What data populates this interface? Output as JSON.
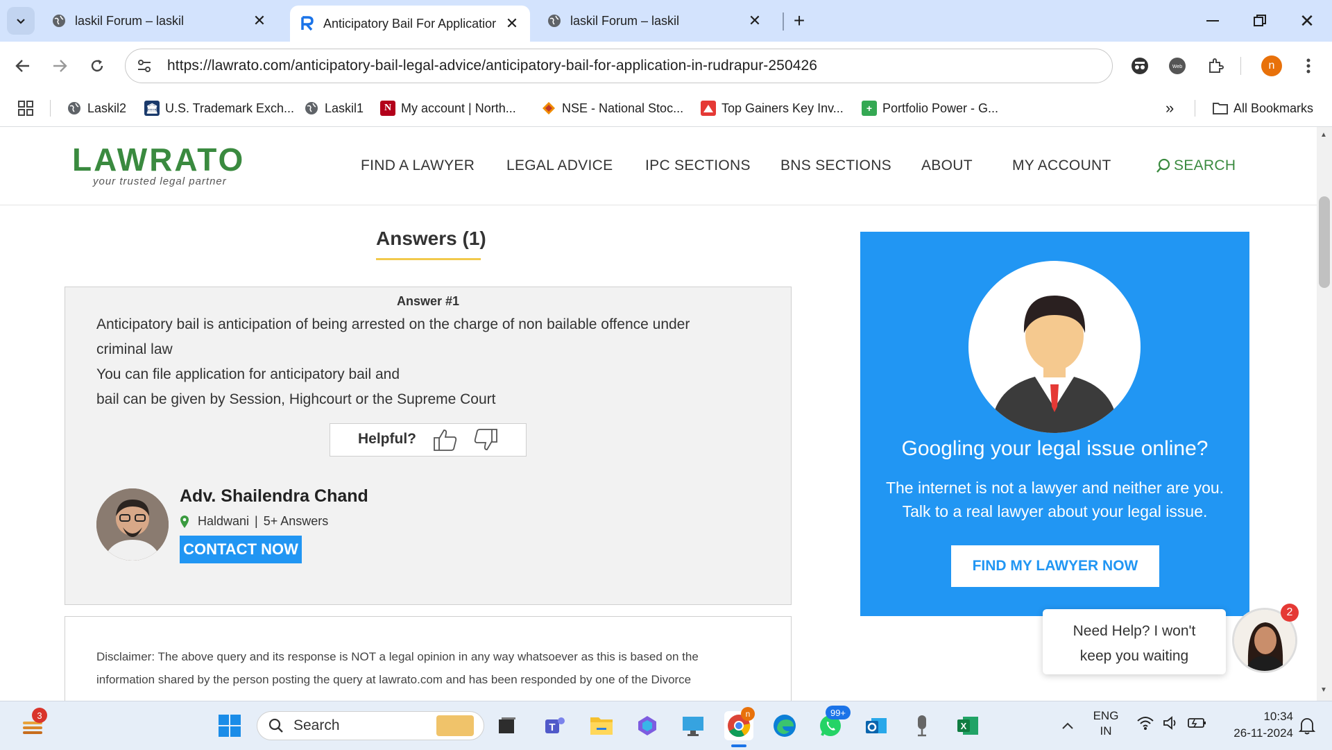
{
  "browser": {
    "tabs": [
      {
        "title": "laskil Forum – laskil",
        "active": false
      },
      {
        "title": "Anticipatory Bail For Applicatior",
        "active": true
      },
      {
        "title": "laskil Forum – laskil",
        "active": false
      }
    ],
    "url": "https://lawrato.com/anticipatory-bail-legal-advice/anticipatory-bail-for-application-in-rudrapur-250426",
    "profile_initial": "n",
    "bookmarks": [
      {
        "label": "Laskil2",
        "icon": "globe-icon"
      },
      {
        "label": "U.S. Trademark Exch...",
        "icon": "bank-icon"
      },
      {
        "label": "Laskil1",
        "icon": "globe-icon"
      },
      {
        "label": "My account | North...",
        "icon": "n-logo-icon"
      },
      {
        "label": "NSE - National Stoc...",
        "icon": "nse-icon"
      },
      {
        "label": "Top Gainers Key Inv...",
        "icon": "chart-icon"
      },
      {
        "label": "Portfolio Power - G...",
        "icon": "sheet-icon"
      }
    ],
    "all_bookmarks": "All Bookmarks",
    "more_bookmarks": "»"
  },
  "site": {
    "logo_text": "LAWRATO",
    "tagline": "your trusted legal partner",
    "nav": [
      "FIND A LAWYER",
      "LEGAL ADVICE",
      "IPC SECTIONS",
      "BNS SECTIONS",
      "ABOUT",
      "MY ACCOUNT"
    ],
    "search": "SEARCH",
    "brand_color": "#3a8a3f"
  },
  "content": {
    "answers_heading": "Answers (1)",
    "answer": {
      "number": "Answer #1",
      "lines": [
        "Anticipatory bail is anticipation of being arrested on the charge of non bailable offence under",
        "criminal law",
        "You can file application for anticipatory bail and",
        "bail can be given by Session, Highcourt or the Supreme Court"
      ],
      "helpful_label": "Helpful?",
      "lawyer_name": "Adv. Shailendra Chand",
      "lawyer_location": "Haldwani",
      "lawyer_answers": "5+ Answers",
      "contact_button": "CONTACT NOW"
    },
    "disclaimer_lines": [
      "Disclaimer: The above query and its response is NOT a legal opinion in any way whatsoever as this is based on the",
      "information shared by the person posting the query at lawrato.com and has been responded by one of the Divorce"
    ]
  },
  "promo": {
    "heading": "Googling your legal issue online?",
    "line1": "The internet is not a lawyer and neither are you.",
    "line2": "Talk to a real lawyer about your legal issue.",
    "button": "FIND MY LAWYER NOW",
    "bg_color": "#2196f3"
  },
  "chat": {
    "message_line1": "Need Help? I won't",
    "message_line2": "keep you waiting",
    "badge": "2"
  },
  "taskbar": {
    "widget_badge": "3",
    "search_placeholder": "Search",
    "whatsapp_badge": "99+",
    "chrome_badge": "n",
    "lang_line1": "ENG",
    "lang_line2": "IN",
    "time": "10:34",
    "date": "26-11-2024"
  }
}
